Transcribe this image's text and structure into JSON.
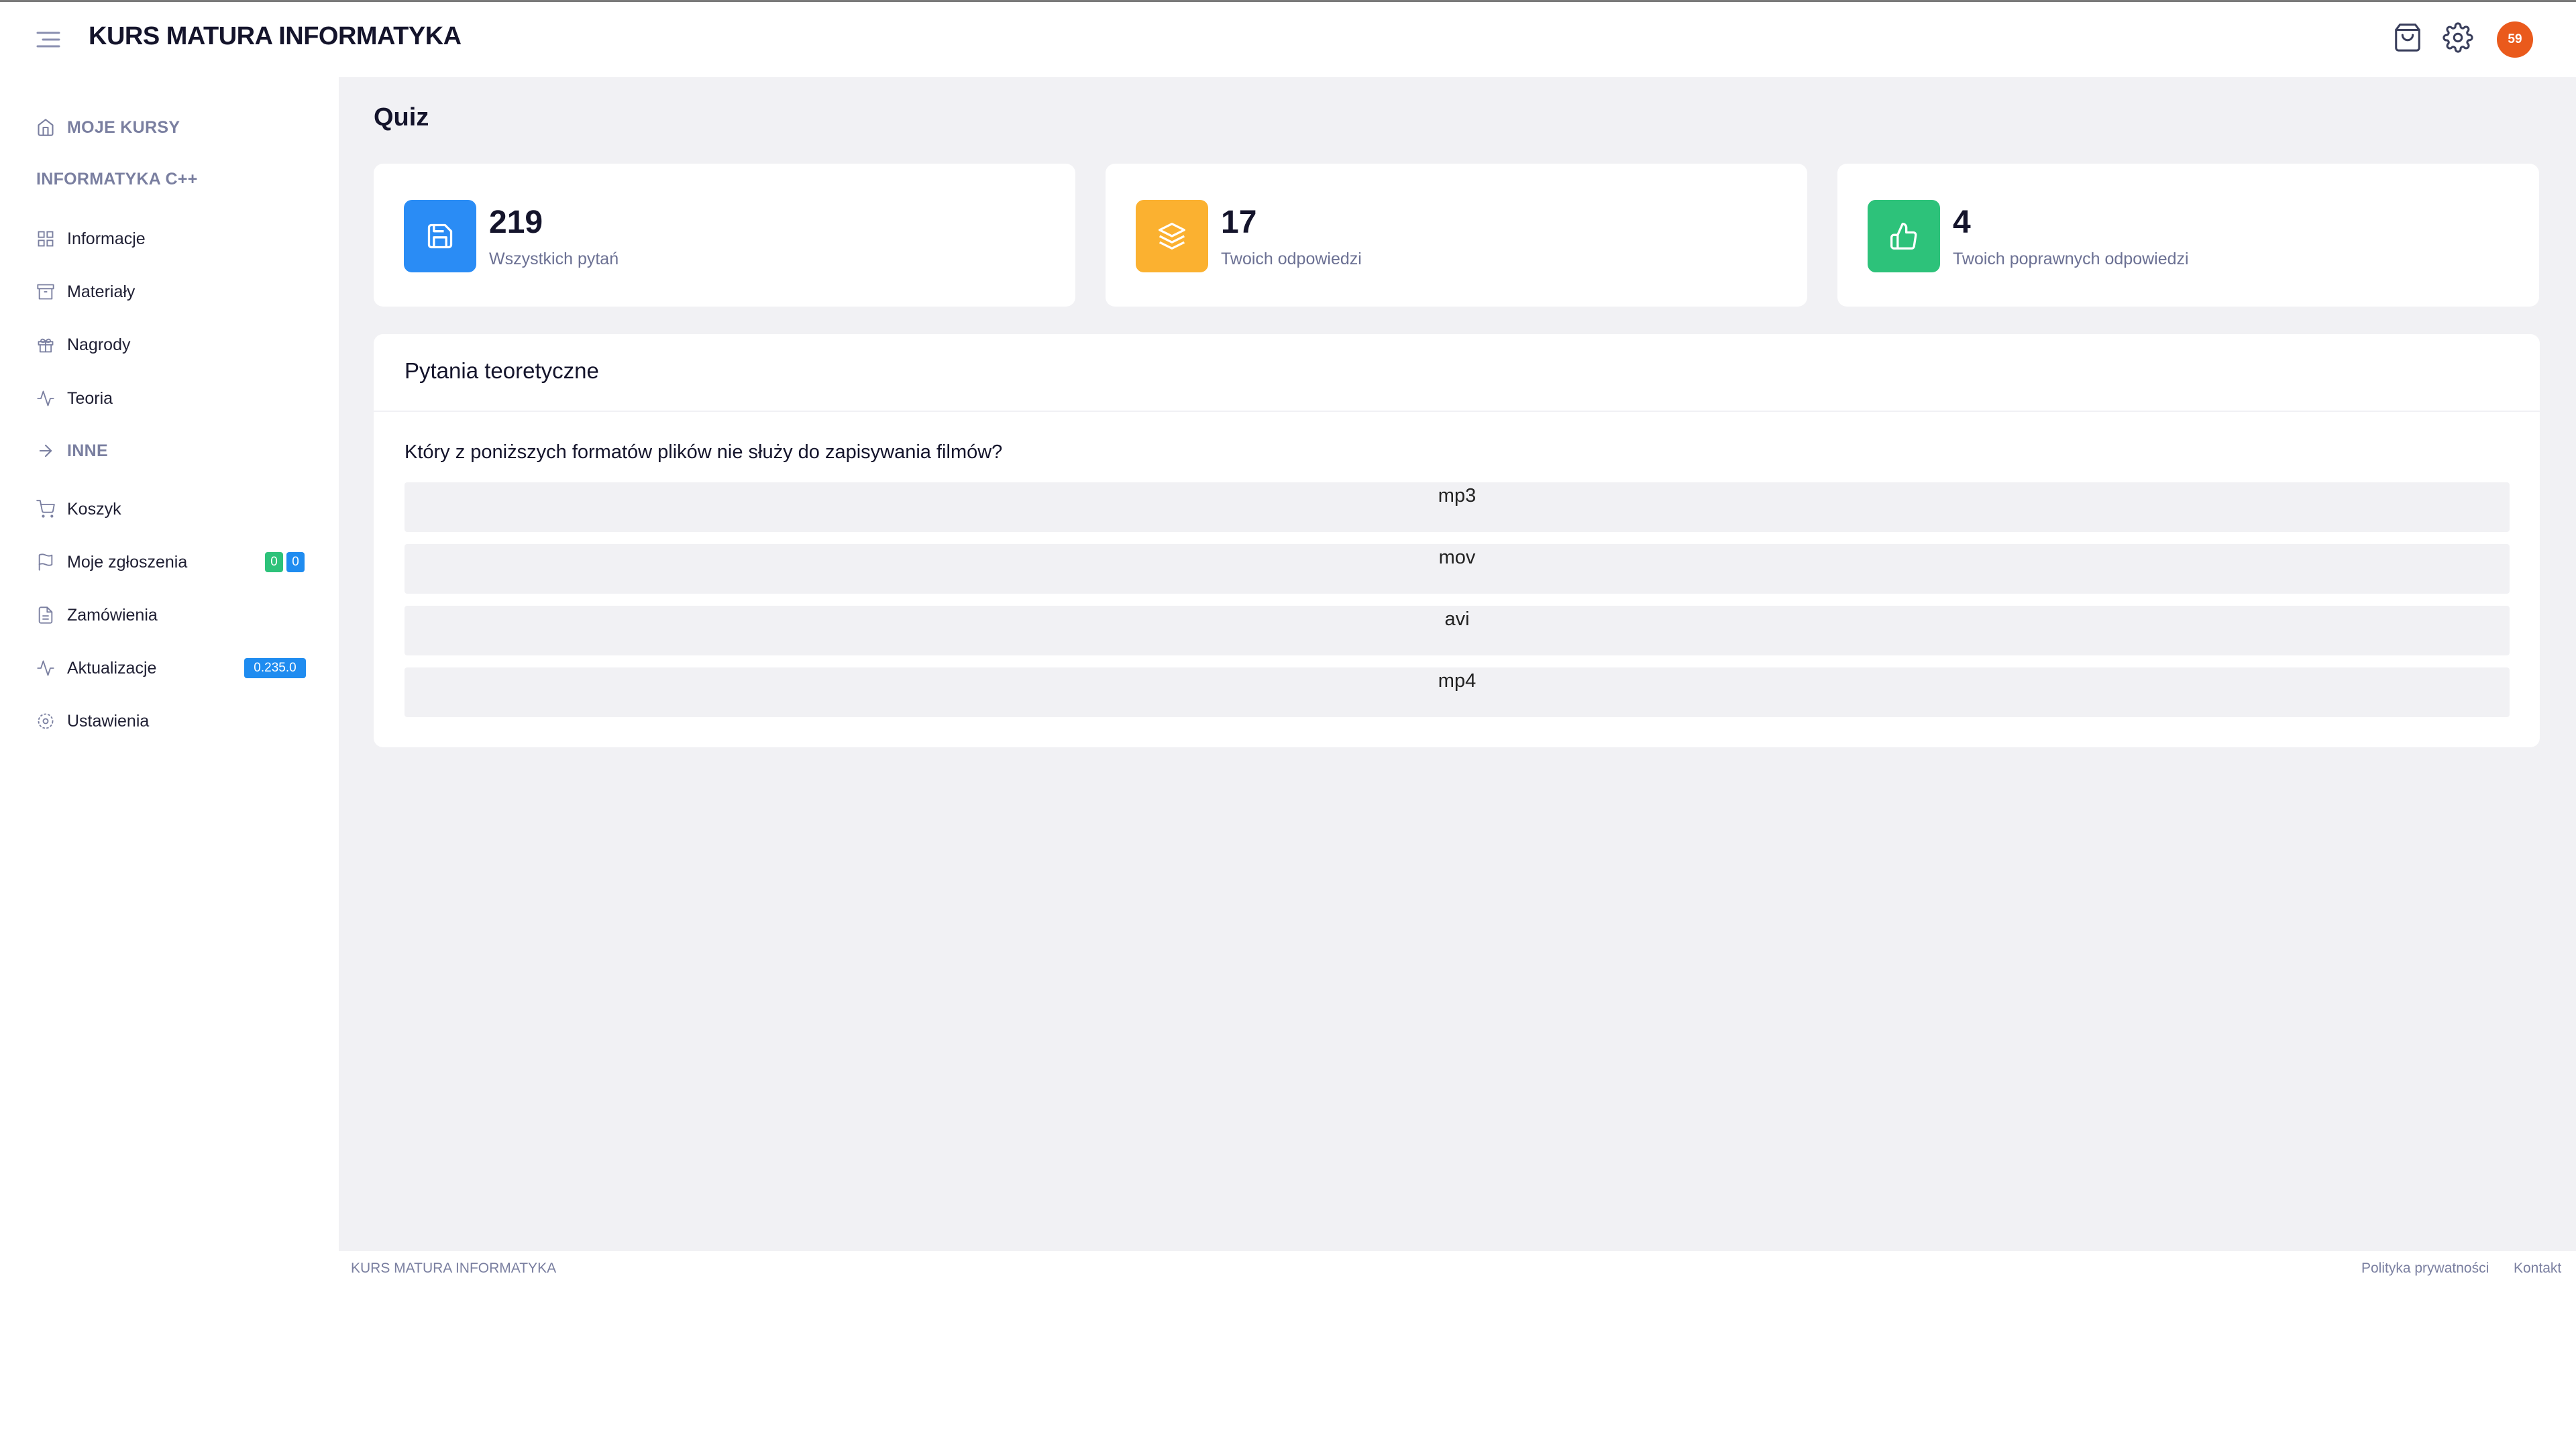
{
  "header": {
    "brand": "KURS MATURA INFORMATYKA",
    "avatar_text": "59",
    "icons": [
      "menu-icon",
      "shopping-bag-icon",
      "gear-icon"
    ]
  },
  "sidebar": {
    "my_courses": "MOJE KURSY",
    "course_heading": "INFORMATYKA C++",
    "items": [
      {
        "label": "Informacje",
        "icon": "grid-icon"
      },
      {
        "label": "Materiały",
        "icon": "archive-icon"
      },
      {
        "label": "Nagrody",
        "icon": "gift-icon"
      },
      {
        "label": "Teoria",
        "icon": "activity-icon"
      }
    ],
    "other_section": "INNE",
    "other_items": [
      {
        "label": "Koszyk",
        "icon": "cart-icon"
      },
      {
        "label": "Moje zgłoszenia",
        "icon": "flag-icon",
        "badges": [
          "0",
          "0"
        ]
      },
      {
        "label": "Zamówienia",
        "icon": "document-icon"
      },
      {
        "label": "Aktualizacje",
        "icon": "activity-icon",
        "badge": "0.235.0"
      },
      {
        "label": "Ustawienia",
        "icon": "gear-icon"
      }
    ]
  },
  "main": {
    "title": "Quiz",
    "stats": [
      {
        "value": "219",
        "label": "Wszystkich pytań",
        "color": "#2a8cf5",
        "icon": "save-icon"
      },
      {
        "value": "17",
        "label": "Twoich odpowiedzi",
        "color": "#fbb130",
        "icon": "layers-icon"
      },
      {
        "value": "4",
        "label": "Twoich poprawnych odpowiedzi",
        "color": "#2dc27a",
        "icon": "thumbs-up-icon"
      }
    ],
    "question_section": "Pytania teoretyczne",
    "question": "Który z poniższych formatów plików nie służy do zapisywania filmów?",
    "answers": [
      "mp3",
      "mov",
      "avi",
      "mp4"
    ]
  },
  "footer": {
    "brand": "KURS MATURA INFORMATYKA",
    "links": [
      "Polityka prywatności",
      "Kontakt"
    ]
  },
  "colors": {
    "badge_green": "#2dc27a",
    "badge_blue": "#1f8cf0",
    "avatar": "#ea5a1c"
  }
}
